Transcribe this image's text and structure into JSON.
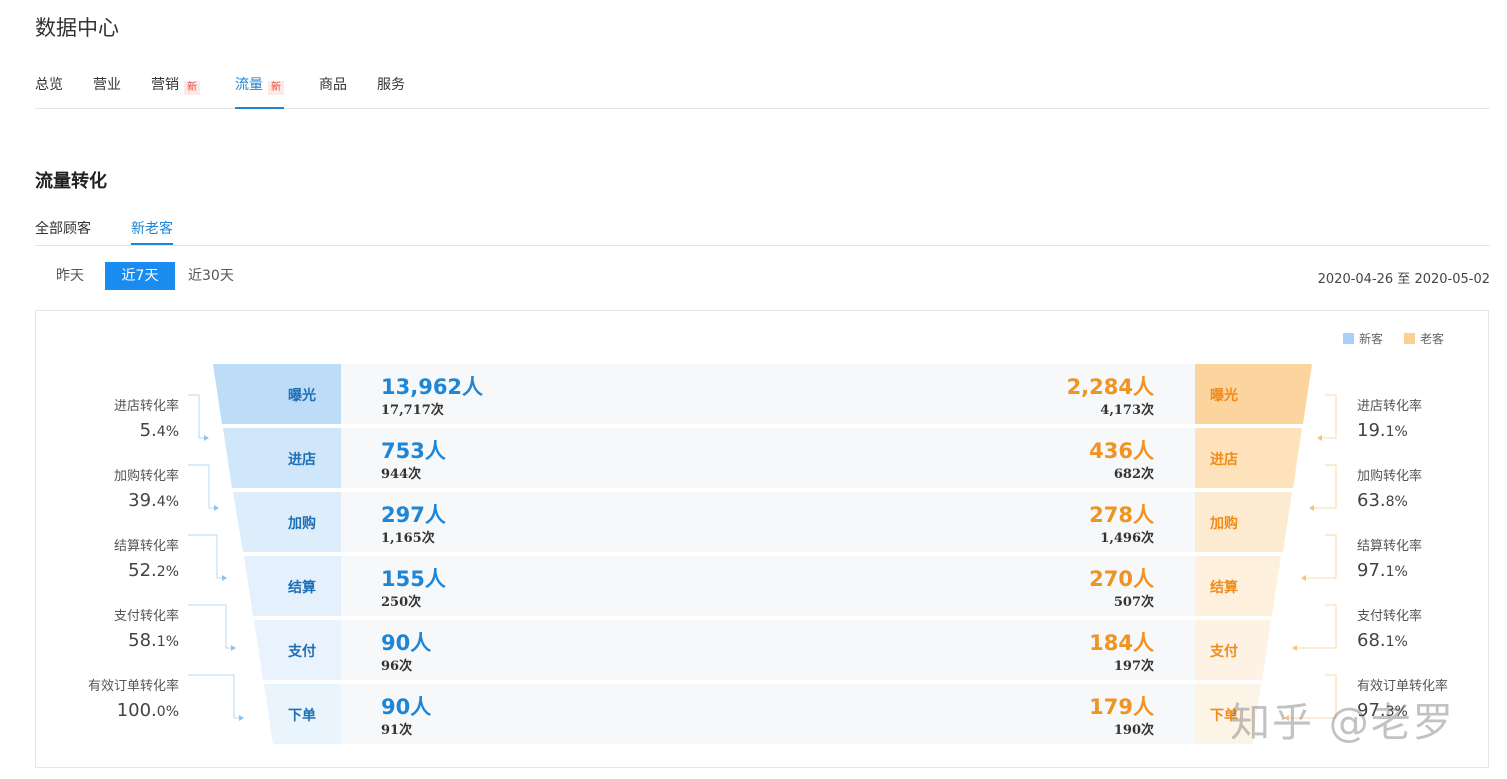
{
  "app": {
    "title": "数据中心"
  },
  "top_tabs": [
    {
      "label": "总览",
      "new": false
    },
    {
      "label": "营业",
      "new": false
    },
    {
      "label": "营销",
      "new": true
    },
    {
      "label": "流量",
      "new": true,
      "active": true
    },
    {
      "label": "商品",
      "new": false
    },
    {
      "label": "服务",
      "new": false
    }
  ],
  "new_badge": "新",
  "section": {
    "title": "流量转化"
  },
  "sub_tabs": [
    {
      "label": "全部顾客"
    },
    {
      "label": "新老客",
      "active": true
    }
  ],
  "ranges": [
    {
      "label": "昨天"
    },
    {
      "label": "近7天",
      "active": true
    },
    {
      "label": "近30天"
    }
  ],
  "date_range": "2020-04-26 至 2020-05-02",
  "legend": {
    "new": "新客",
    "old": "老客"
  },
  "colors": {
    "accent": "#1a8cf0",
    "new_blue": "#1f86d6",
    "old_orange": "#ef9323"
  },
  "funnel": {
    "stages": [
      {
        "name": "曝光",
        "new_people": "13,962人",
        "new_times": "17,717次",
        "old_people": "2,284人",
        "old_times": "4,173次"
      },
      {
        "name": "进店",
        "new_people": "753人",
        "new_times": "944次",
        "old_people": "436人",
        "old_times": "682次"
      },
      {
        "name": "加购",
        "new_people": "297人",
        "new_times": "1,165次",
        "old_people": "278人",
        "old_times": "1,496次"
      },
      {
        "name": "结算",
        "new_people": "155人",
        "new_times": "250次",
        "old_people": "270人",
        "old_times": "507次"
      },
      {
        "name": "支付",
        "new_people": "90人",
        "new_times": "96次",
        "old_people": "184人",
        "old_times": "197次"
      },
      {
        "name": "下单",
        "new_people": "90人",
        "new_times": "91次",
        "old_people": "179人",
        "old_times": "190次"
      }
    ],
    "new_rates": [
      {
        "label": "进店转化率",
        "int": "5.",
        "dec": "4%"
      },
      {
        "label": "加购转化率",
        "int": "39.",
        "dec": "4%"
      },
      {
        "label": "结算转化率",
        "int": "52.",
        "dec": "2%"
      },
      {
        "label": "支付转化率",
        "int": "58.",
        "dec": "1%"
      },
      {
        "label": "有效订单转化率",
        "int": "100.",
        "dec": "0%"
      }
    ],
    "old_rates": [
      {
        "label": "进店转化率",
        "int": "19.",
        "dec": "1%"
      },
      {
        "label": "加购转化率",
        "int": "63.",
        "dec": "8%"
      },
      {
        "label": "结算转化率",
        "int": "97.",
        "dec": "1%"
      },
      {
        "label": "支付转化率",
        "int": "68.",
        "dec": "1%"
      },
      {
        "label": "有效订单转化率",
        "int": "97.",
        "dec": "3%"
      }
    ]
  },
  "watermark": "知乎 @老罗"
}
